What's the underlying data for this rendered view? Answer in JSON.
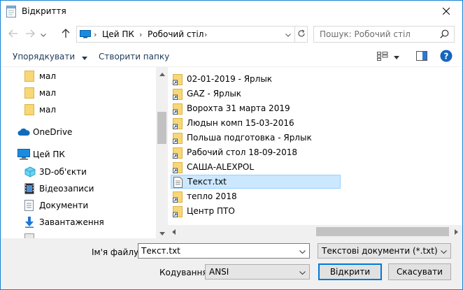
{
  "window": {
    "title": "Відкриття"
  },
  "address": {
    "crumbs": [
      "Цей ПК",
      "Робочий стіл"
    ]
  },
  "search": {
    "placeholder": "Пошук: Робочий стіл"
  },
  "toolbar": {
    "organize_label": "Упорядкувати",
    "new_folder_label": "Створити папку"
  },
  "sidebar": {
    "items": [
      {
        "label": "мал",
        "icon": "folder-icon"
      },
      {
        "label": "мал",
        "icon": "folder-icon"
      },
      {
        "label": "мал",
        "icon": "folder-icon"
      },
      {
        "label": "OneDrive",
        "icon": "cloud-icon"
      },
      {
        "label": "Цей ПК",
        "icon": "computer-icon"
      },
      {
        "label": "3D-об'єкти",
        "icon": "cube-icon"
      },
      {
        "label": "Відеозаписи",
        "icon": "film-icon"
      },
      {
        "label": "Документи",
        "icon": "document-icon"
      },
      {
        "label": "Завантаження",
        "icon": "download-icon"
      }
    ]
  },
  "files": [
    {
      "name": "02-01-2019 - Ярлык",
      "icon": "folder-shortcut-icon"
    },
    {
      "name": "GAZ - Ярлык",
      "icon": "folder-shortcut-icon"
    },
    {
      "name": "Ворохта 31 марта 2019",
      "icon": "folder-shortcut-icon"
    },
    {
      "name": "Людын комп 15-03-2016",
      "icon": "folder-shortcut-icon"
    },
    {
      "name": "Польша подготовка - Ярлык",
      "icon": "folder-shortcut-icon"
    },
    {
      "name": "Рабочий стол 18-09-2018",
      "icon": "folder-shortcut-icon"
    },
    {
      "name": "САША-ALEXPOL",
      "icon": "folder-shortcut-icon"
    },
    {
      "name": "Текст.txt",
      "icon": "text-file-icon",
      "selected": true
    },
    {
      "name": "тепло 2018",
      "icon": "folder-shortcut-icon"
    },
    {
      "name": "Центр ПТО",
      "icon": "folder-shortcut-icon"
    }
  ],
  "bottom": {
    "filename_label": "Ім'я файлу:",
    "filename_value": "Текст.txt",
    "filetype_value": "Текстові документи (*.txt)",
    "encoding_label": "Кодування:",
    "encoding_value": "ANSI",
    "open_label": "Відкрити",
    "cancel_label": "Скасувати"
  },
  "colors": {
    "accent": "#0078d7",
    "selection": "#cce8ff",
    "folder": "#f8d775"
  }
}
